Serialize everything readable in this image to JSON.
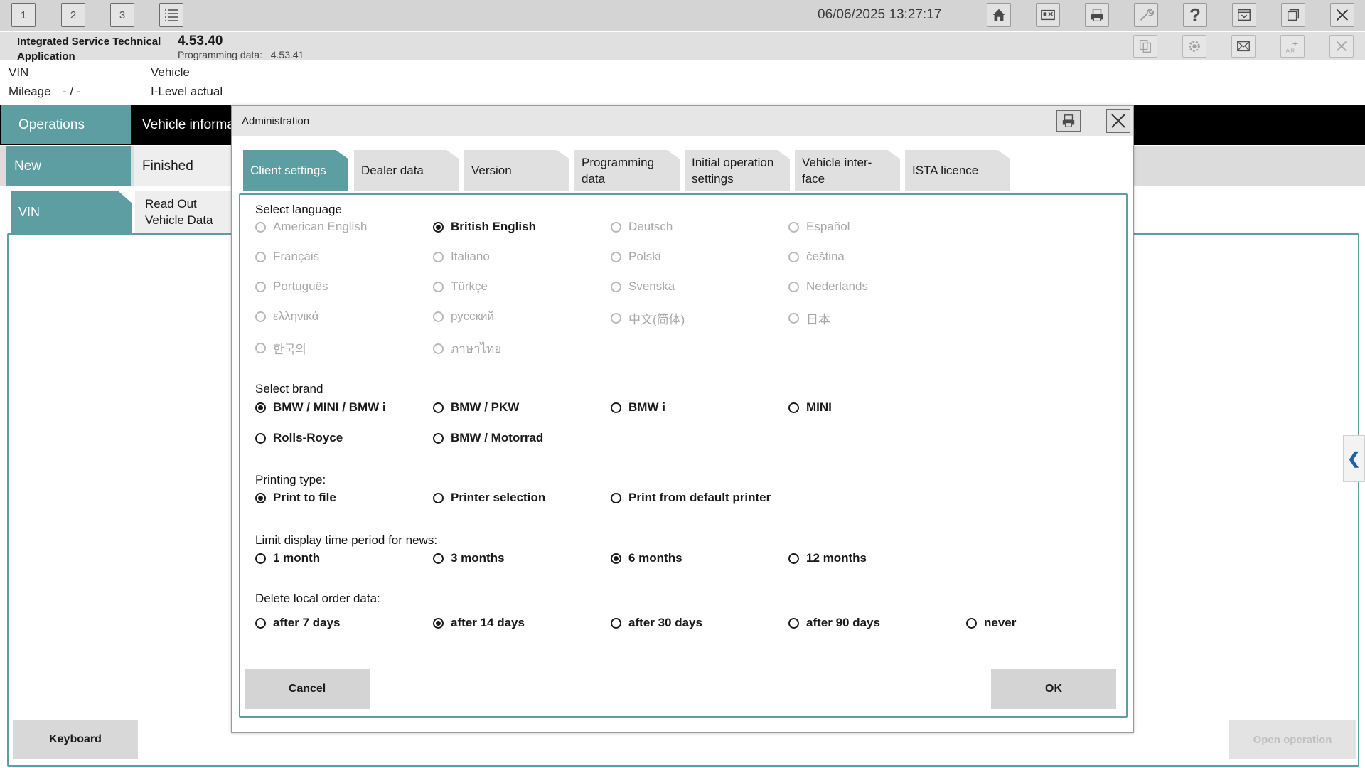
{
  "toolbar": {
    "tab1": "1",
    "tab2": "2",
    "tab3": "3",
    "datetime": "06/06/2025 13:27:17"
  },
  "header": {
    "app_name": "Integrated Service Technical Application",
    "version": "4.53.40",
    "programming_label": "Programming data:",
    "programming_version": "4.53.41"
  },
  "vehicle": {
    "vin_label": "VIN",
    "mileage_label": "Mileage",
    "mileage_value": "- / -",
    "vehicle_label": "Vehicle",
    "ilevel_label": "I-Level actual"
  },
  "nav": {
    "operations": "Operations",
    "vehicle_info": "Vehicle informa",
    "new": "New",
    "finished": "Finished",
    "vin": "VIN",
    "read_out": "Read Out Vehicle Data"
  },
  "bottom": {
    "keyboard": "Keyboard",
    "open_operation": "Open operation"
  },
  "dialog": {
    "title": "Administration",
    "tabs": [
      {
        "label": "Client settings",
        "active": true
      },
      {
        "label": "Dealer data",
        "active": false
      },
      {
        "label": "Version",
        "active": false
      },
      {
        "label": "Programming data",
        "active": false
      },
      {
        "label": "Initial operation settings",
        "active": false
      },
      {
        "label": "Vehicle inter-face",
        "active": false
      },
      {
        "label": "ISTA licence",
        "active": false
      }
    ],
    "language": {
      "title": "Select language",
      "options": [
        "American English",
        "British English",
        "Deutsch",
        "Español",
        "Français",
        "Italiano",
        "Polski",
        "čeština",
        "Português",
        "Türkçe",
        "Svenska",
        "Nederlands",
        "ελληνικά",
        "русский",
        "中文(简体)",
        "日本",
        "한국의",
        "ภาษาไทย"
      ],
      "selected": "British English"
    },
    "brand": {
      "title": "Select brand",
      "options": [
        "BMW / MINI / BMW i",
        "BMW / PKW",
        "BMW i",
        "MINI",
        "Rolls-Royce",
        "BMW / Motorrad"
      ],
      "selected": "BMW / MINI / BMW i"
    },
    "printing": {
      "title": "Printing type:",
      "options": [
        "Print to file",
        "Printer selection",
        "Print from default printer"
      ],
      "selected": "Print to file"
    },
    "news": {
      "title": "Limit display time period for news:",
      "options": [
        "1 month",
        "3 months",
        "6 months",
        "12 months"
      ],
      "selected": "6 months"
    },
    "delete": {
      "title": "Delete local order data:",
      "options": [
        "after 7 days",
        "after 14 days",
        "after 30 days",
        "after 90 days",
        "never"
      ],
      "selected": "after 14 days"
    },
    "cancel": "Cancel",
    "ok": "OK"
  },
  "colors": {
    "accent": "#5d9ea2",
    "toolbar_bg": "#d4d4d4",
    "disabled_text": "#a8a8a8"
  }
}
